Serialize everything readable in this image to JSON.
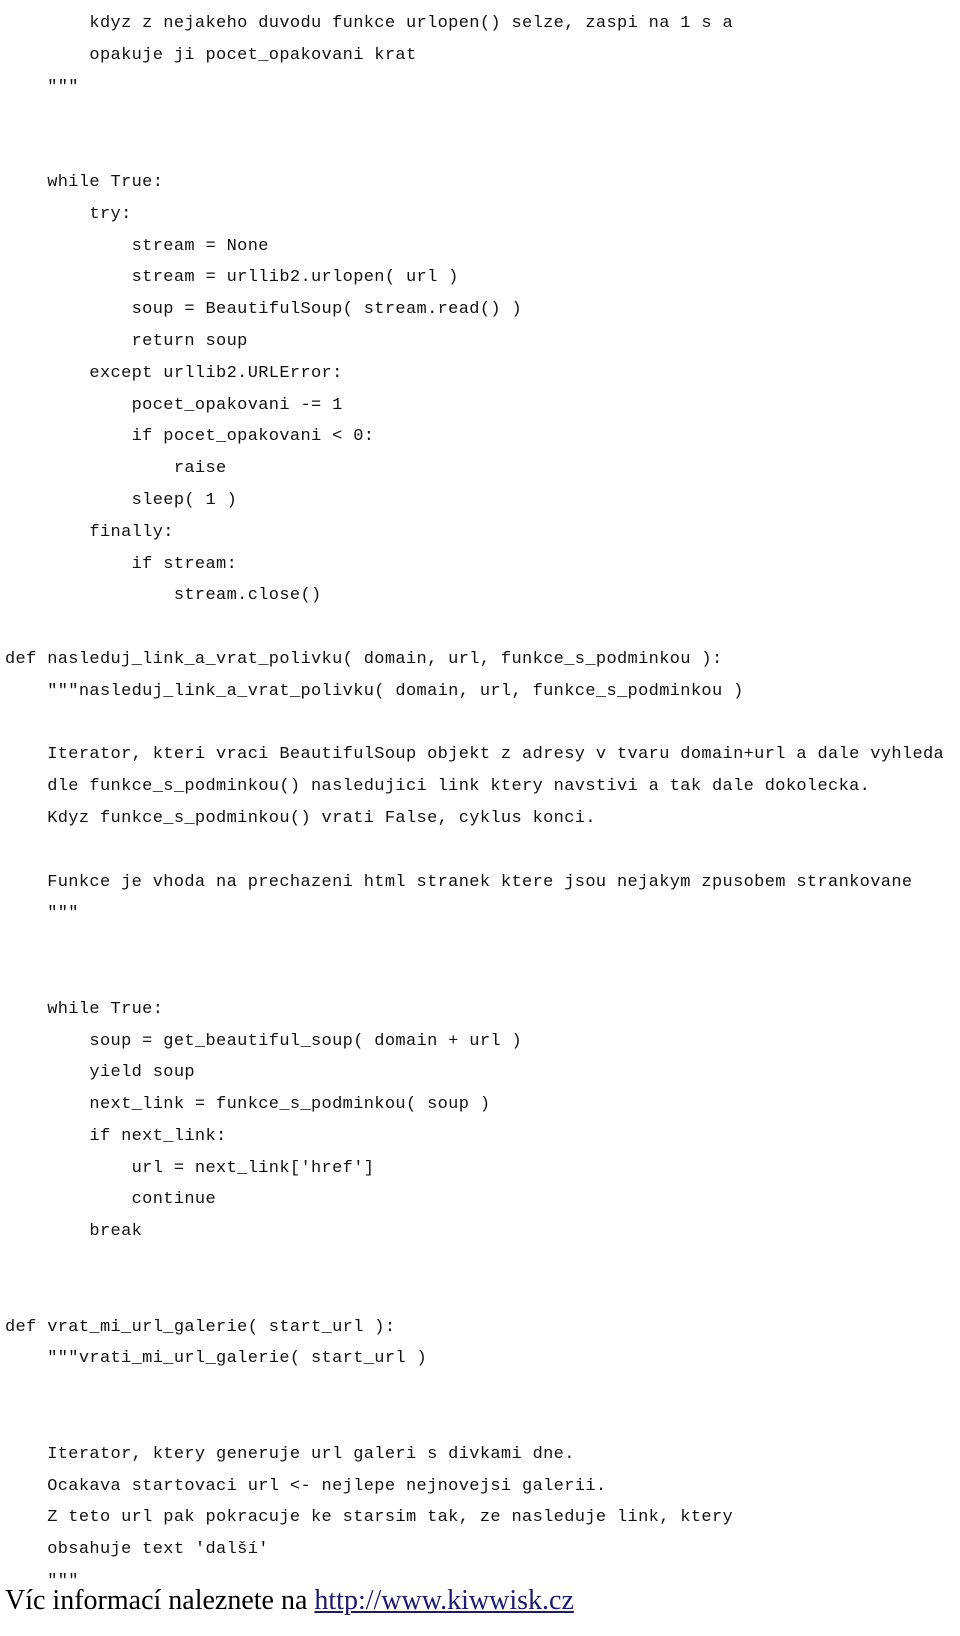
{
  "page": {
    "background_color": "#ffffff",
    "text_color": "#111111",
    "link_color": "#1a1a6e"
  },
  "code": {
    "language": "python",
    "lines": [
      "        kdyz z nejakeho duvodu funkce urlopen() selze, zaspi na 1 s a",
      "        opakuje ji pocet_opakovani krat",
      "    \"\"\"",
      "",
      "",
      "    while True:",
      "        try:",
      "            stream = None",
      "            stream = urllib2.urlopen( url )",
      "            soup = BeautifulSoup( stream.read() )",
      "            return soup",
      "        except urllib2.URLError:",
      "            pocet_opakovani -= 1",
      "            if pocet_opakovani < 0:",
      "                raise",
      "            sleep( 1 )",
      "        finally:",
      "            if stream:",
      "                stream.close()",
      "",
      "def nasleduj_link_a_vrat_polivku( domain, url, funkce_s_podminkou ):",
      "    \"\"\"nasleduj_link_a_vrat_polivku( domain, url, funkce_s_podminkou )",
      "",
      "    Iterator, kteri vraci BeautifulSoup objekt z adresy v tvaru domain+url a dale vyhleda",
      "    dle funkce_s_podminkou() nasledujici link ktery navstivi a tak dale dokolecka.",
      "    Kdyz funkce_s_podminkou() vrati False, cyklus konci.",
      "",
      "    Funkce je vhoda na prechazeni html stranek ktere jsou nejakym zpusobem strankovane",
      "    \"\"\"",
      "",
      "",
      "    while True:",
      "        soup = get_beautiful_soup( domain + url )",
      "        yield soup",
      "        next_link = funkce_s_podminkou( soup )",
      "        if next_link:",
      "            url = next_link['href']",
      "            continue",
      "        break",
      "",
      "",
      "def vrat_mi_url_galerie( start_url ):",
      "    \"\"\"vrati_mi_url_galerie( start_url )",
      "",
      "",
      "    Iterator, ktery generuje url galeri s divkami dne.",
      "    Ocakava startovaci url <- nejlepe nejnovejsi galerii.",
      "    Z teto url pak pokracuje ke starsim tak, ze nasleduje link, ktery",
      "    obsahuje text 'další'",
      "    \"\"\""
    ]
  },
  "footer": {
    "prefix": "Víc informací naleznete na ",
    "link_text": "http://www.kiwwisk.cz"
  }
}
